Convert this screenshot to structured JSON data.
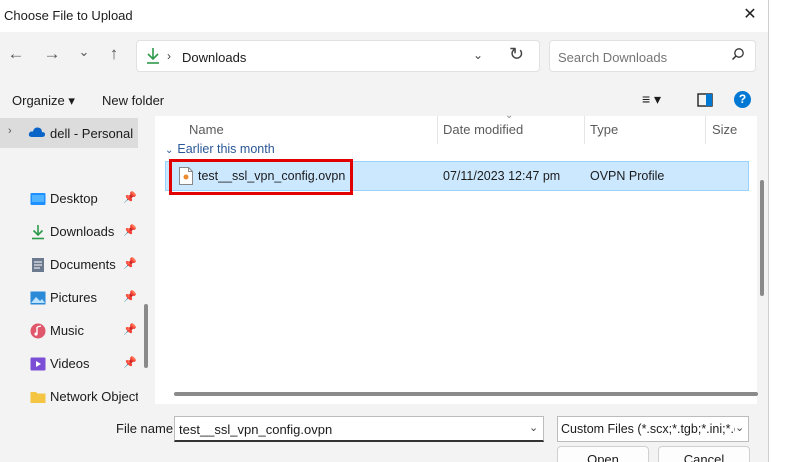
{
  "window": {
    "title": "Choose File to Upload",
    "close_glyph": "✕"
  },
  "nav": {
    "back_glyph": "←",
    "forward_glyph": "→",
    "recent_glyph": "⌄",
    "up_glyph": "↑",
    "breadcrumb": "Downloads",
    "breadcrumb_sep": "›",
    "address_chevron": "⌄",
    "refresh_glyph": "↻"
  },
  "search": {
    "placeholder": "Search Downloads",
    "icon_glyph": "⚲"
  },
  "toolbar": {
    "organize": "Organize ▾",
    "new_folder": "New folder",
    "view_glyph": "≡ ▾",
    "help_glyph": "?"
  },
  "sidebar": {
    "onedrive": "dell - Personal",
    "items": [
      {
        "label": "Desktop",
        "icon": "desktop-icon",
        "color": "#1e90ff"
      },
      {
        "label": "Downloads",
        "icon": "download-icon",
        "color": "#2d9a4a"
      },
      {
        "label": "Documents",
        "icon": "documents-icon",
        "color": "#6b7a8f"
      },
      {
        "label": "Pictures",
        "icon": "pictures-icon",
        "color": "#2a8ad8"
      },
      {
        "label": "Music",
        "icon": "music-icon",
        "color": "#e0566b"
      },
      {
        "label": "Videos",
        "icon": "videos-icon",
        "color": "#7a4fd6"
      },
      {
        "label": "Network Objects",
        "icon": "folder-icon",
        "color": "#f4c542"
      }
    ]
  },
  "columns": {
    "name": "Name",
    "date": "Date modified",
    "type": "Type",
    "size": "Size",
    "sort_glyph": "⌄"
  },
  "group": {
    "label": "Earlier this month",
    "chevron": "⌄"
  },
  "files": [
    {
      "name": "test__ssl_vpn_config.ovpn",
      "date": "07/11/2023 12:47 pm",
      "type": "OVPN Profile"
    }
  ],
  "footer": {
    "file_name_label": "File name:",
    "file_name_value": "test__ssl_vpn_config.ovpn",
    "file_type": "Custom Files (*.scx;*.tgb;*.ini;*.ovpn)",
    "open": "Open",
    "cancel": "Cancel",
    "chevron": "⌄"
  },
  "colors": {
    "accent": "#0078d4",
    "selection": "#cce8ff",
    "highlight_box": "#e00000"
  }
}
